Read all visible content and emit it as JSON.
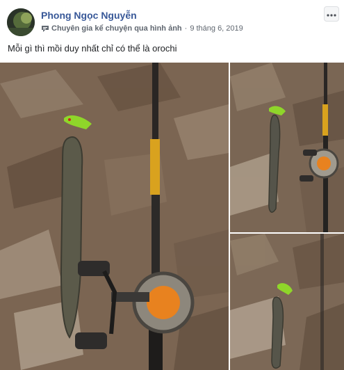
{
  "post": {
    "author_name": "Phong Ngọc Nguyễn",
    "badge": "Chuyên gia kể chuyện qua hình ảnh",
    "separator": "·",
    "date": "9 tháng 6, 2019",
    "caption": "Mỗi gì thì mồi duy nhất chỉ có thể là orochi"
  },
  "colors": {
    "author_link": "#385898",
    "meta_text": "#606770",
    "leaf_bg": "#7b6552",
    "rod_gold": "#d9a21e",
    "line_orange": "#e8821f",
    "lure_green": "#8fd62a"
  },
  "icons": {
    "badge": "speech-bubble-badge-icon",
    "more": "more-options-icon"
  }
}
